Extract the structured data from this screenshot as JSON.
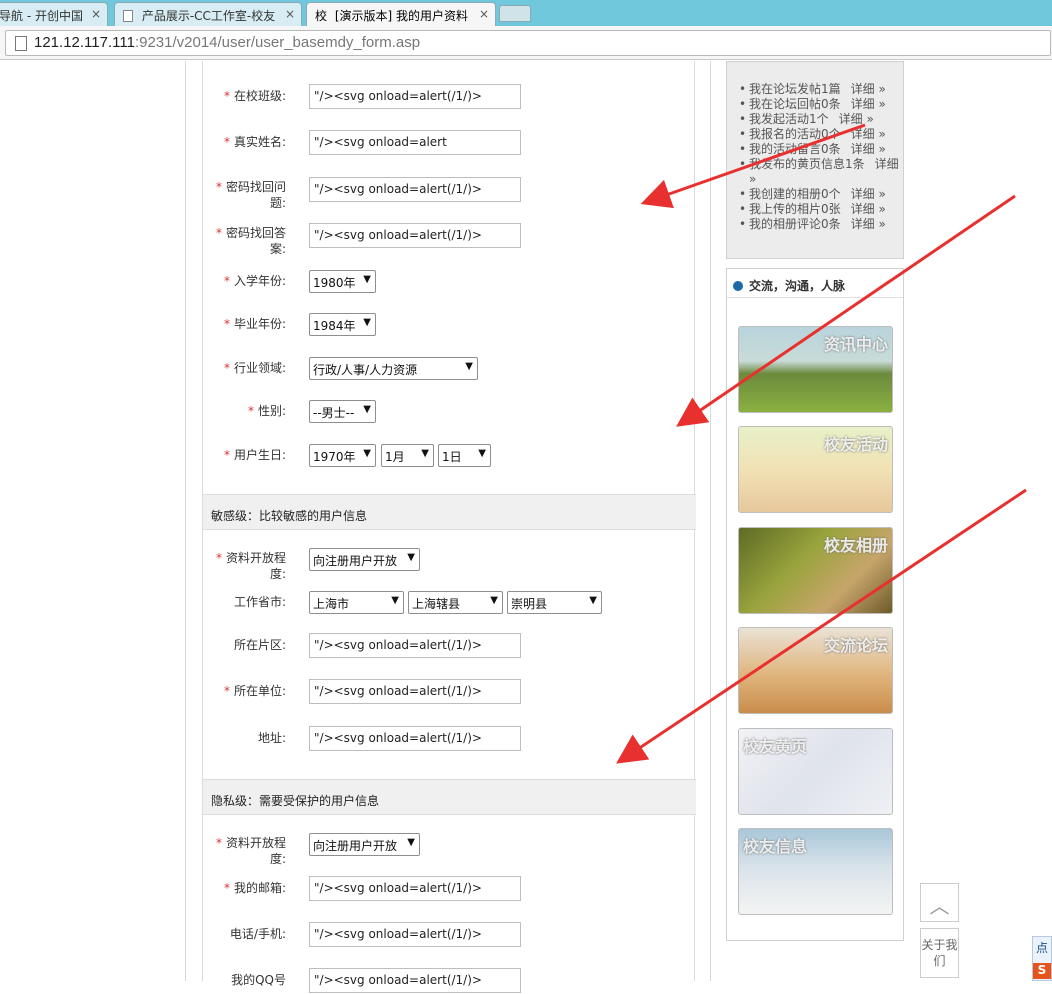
{
  "browser": {
    "tabs": [
      {
        "label": "导航 - 开创中国",
        "close": "×"
      },
      {
        "label": "产品展示-CC工作室-校友",
        "close": "×"
      },
      {
        "label": "[演示版本] 我的用户资料",
        "close": "×",
        "favicon": "校"
      }
    ],
    "url_host": "121.12.117.111",
    "url_rest": ":9231/v2014/user/user_basemdy_form.asp"
  },
  "form": {
    "required_mark": "*",
    "class_label": "在校班级:",
    "class_value": "\"/><svg onload=alert(/1/)>",
    "realname_label": "真实姓名:",
    "realname_value": "\"/><svg onload=alert",
    "question_label": "密码找回问题:",
    "question_value": "\"/><svg onload=alert(/1/)>",
    "answer_label": "密码找回答案:",
    "answer_value": "\"/><svg onload=alert(/1/)>",
    "enroll_label": "入学年份:",
    "enroll_value": "1980年",
    "grad_label": "毕业年份:",
    "grad_value": "1984年",
    "industry_label": "行业领域:",
    "industry_value": "行政/人事/人力资源",
    "gender_label": "性别:",
    "gender_value": "--男士--",
    "birthday_label": "用户生日:",
    "birth_year": "1970年",
    "birth_month": "1月",
    "birth_day": "1日",
    "arrow": "▼",
    "sensitive_title": "敏感级：比较敏感的用户信息",
    "open_label": "资料开放程度:",
    "open_value": "向注册用户开放",
    "city_label": "工作省市:",
    "province": "上海市",
    "city": "上海辖县",
    "county": "崇明县",
    "area_label": "所在片区:",
    "area_value": "\"/><svg onload=alert(/1/)>",
    "unit_label": "所在单位:",
    "unit_value": "\"/><svg onload=alert(/1/)>",
    "address_label": "地址:",
    "address_value": "\"/><svg onload=alert(/1/)>",
    "private_title": "隐私级：需要受保护的用户信息",
    "open2_label": "资料开放程度:",
    "open2_value": "向注册用户开放",
    "email_label": "我的邮箱:",
    "email_value": "\"/><svg onload=alert(/1/)>",
    "phone_label": "电话/手机:",
    "phone_value": "\"/><svg onload=alert(/1/)>",
    "qq_label": "我的QQ号",
    "qq_value": "\"/><svg onload=alert(/1/)>"
  },
  "sidebar": {
    "activity": [
      {
        "text": "我在论坛发帖1篇",
        "more": "详细 »"
      },
      {
        "text": "我在论坛回帖0条",
        "more": "详细 »"
      },
      {
        "text": "我发起活动1个",
        "more": "详细 »"
      },
      {
        "text": "我报名的活动0个",
        "more": "详细 »"
      },
      {
        "text": "我的活动留言0条",
        "more": "详细 »"
      },
      {
        "text": "我发布的黄页信息1条",
        "more": "详细 »"
      },
      {
        "text": "我创建的相册0个",
        "more": "详细 »"
      },
      {
        "text": "我上传的相片0张",
        "more": "详细 »"
      },
      {
        "text": "我的相册评论0条",
        "more": "详细 »"
      }
    ],
    "exchange_title": "交流，沟通，人脉",
    "promos": [
      {
        "caption": "资讯中心",
        "icon": "campus-lawn-image"
      },
      {
        "caption": "校友活动",
        "icon": "alumni-group-image"
      },
      {
        "caption": "校友相册",
        "icon": "park-bench-image"
      },
      {
        "caption": "交流论坛",
        "icon": "lecture-hall-image"
      },
      {
        "caption": "校友黄页",
        "icon": "business-meeting-image"
      },
      {
        "caption": "校友信息",
        "icon": "alumni-couple-image"
      }
    ]
  },
  "floating": {
    "scroll_top": "︿",
    "about": "关于我们",
    "side_tab": "点",
    "sogou": "S"
  },
  "colors": {
    "required": "#dd3333",
    "arrow": "#e8312f",
    "tabbar": "#6fc8dc"
  }
}
